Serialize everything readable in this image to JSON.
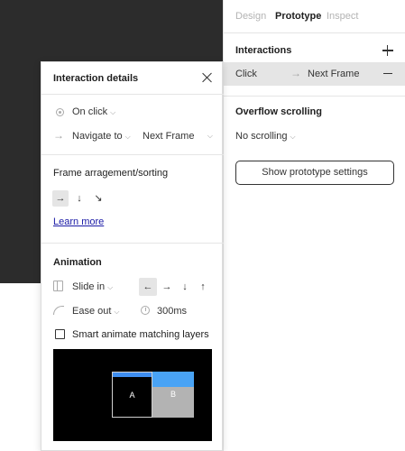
{
  "tabs": [
    {
      "label": "Design"
    },
    {
      "label": "Prototype"
    },
    {
      "label": "Inspect"
    }
  ],
  "interactions": {
    "title": "Interactions",
    "row": {
      "trigger": "Click",
      "target": "Next Frame"
    }
  },
  "overflow": {
    "title": "Overflow scrolling",
    "value": "No scrolling"
  },
  "settings_button": "Show prototype settings",
  "modal": {
    "title": "Interaction details",
    "trigger": "On click",
    "action": "Navigate to",
    "destination": "Next Frame",
    "frame_section_title": "Frame arragement/sorting",
    "learn_more": "Learn more",
    "animation_title": "Animation",
    "animation_type": "Slide in",
    "easing": "Ease out",
    "duration": "300ms",
    "smart_animate_label": "Smart animate matching layers",
    "preview": {
      "frame_a": "A",
      "frame_b": "B"
    }
  },
  "colors": {
    "canvas": "#2c2c2c",
    "accent_blue": "#3f8ef0",
    "link": "#1a1aa6",
    "selected_row": "#e5e5e5"
  },
  "icons": {
    "sort_directions": [
      "arrow-right-icon",
      "arrow-down-icon",
      "arrow-down-right-icon"
    ],
    "slide_directions": [
      "arrow-left-icon",
      "arrow-right-icon",
      "arrow-down-icon",
      "arrow-up-icon"
    ]
  },
  "selected": {
    "sort_direction": 0,
    "slide_direction": 0
  }
}
